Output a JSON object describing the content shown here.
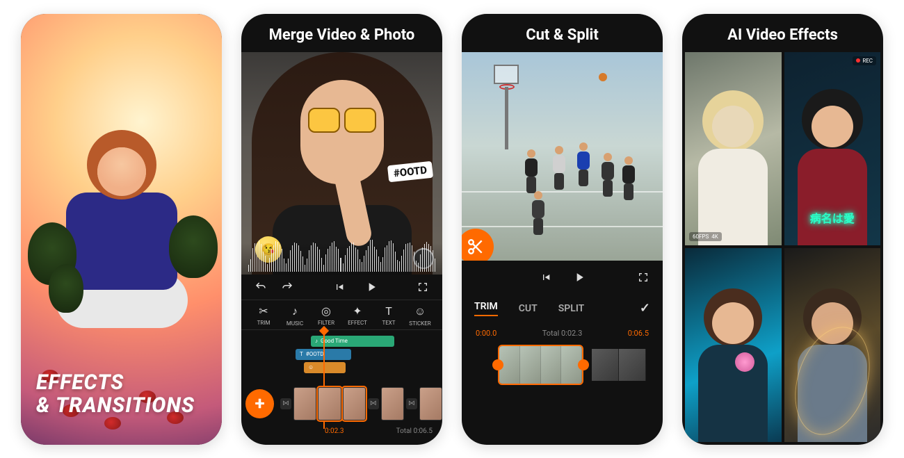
{
  "panel1": {
    "caption_line1": "EFFECTS",
    "caption_line2": "& TRANSITIONS"
  },
  "panel2": {
    "title": "Merge Video & Photo",
    "overlay_hashtag": "#OOTD",
    "tools": {
      "trim": "TRIM",
      "music": "MUSIC",
      "filter": "FILTER",
      "effect": "EFFECT",
      "text": "TEXT",
      "sticker": "STICKER"
    },
    "tracks": {
      "music_label": "Good Time",
      "text_label": "#OOTD"
    },
    "timeline": {
      "current": "0:02.3",
      "total_label": "Total",
      "total": "0:06.5"
    }
  },
  "panel3": {
    "title": "Cut & Split",
    "tabs": {
      "trim": "TRIM",
      "cut": "CUT",
      "split": "SPLIT"
    },
    "times": {
      "start": "0:00.0",
      "total_label": "Total",
      "total": "0:02.3",
      "end": "0:06.5"
    }
  },
  "panel4": {
    "title": "AI Video Effects",
    "rec_label": "REC",
    "fps_label": "60FPS",
    "res_label": "4K",
    "neon_text": "病名は愛"
  }
}
